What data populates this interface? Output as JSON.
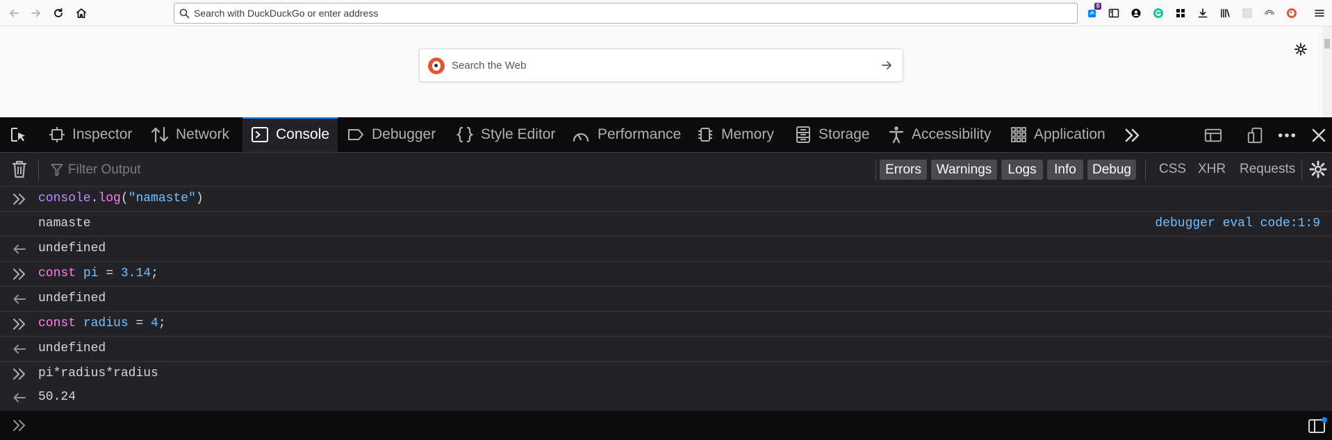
{
  "browser": {
    "urlbar_placeholder": "Search with DuckDuckGo or enter address",
    "extension_badge": "0",
    "icons": [
      "back-arrow-icon",
      "forward-arrow-icon",
      "reload-icon",
      "home-icon",
      "extension-icon",
      "sidebar-icon",
      "account-icon",
      "grammarly-icon",
      "extensions-grid-icon",
      "download-icon",
      "library-icon",
      "container-icon",
      "sync-icon",
      "duckduckgo-icon",
      "hamburger-menu-icon"
    ]
  },
  "page": {
    "ddg_placeholder": "Search the Web"
  },
  "devtools": {
    "tabs": [
      {
        "label": "Inspector",
        "icon": "inspector-icon"
      },
      {
        "label": "Network",
        "icon": "network-icon"
      },
      {
        "label": "Console",
        "icon": "console-icon",
        "selected": true
      },
      {
        "label": "Debugger",
        "icon": "debugger-icon"
      },
      {
        "label": "Style Editor",
        "icon": "style-editor-icon"
      },
      {
        "label": "Performance",
        "icon": "performance-icon"
      },
      {
        "label": "Memory",
        "icon": "memory-icon"
      },
      {
        "label": "Storage",
        "icon": "storage-icon"
      },
      {
        "label": "Accessibility",
        "icon": "accessibility-icon"
      },
      {
        "label": "Application",
        "icon": "application-icon"
      }
    ],
    "accent_color": "#0a84ff",
    "filter_placeholder": "Filter Output",
    "log_filters": [
      "Errors",
      "Warnings",
      "Logs",
      "Info",
      "Debug"
    ],
    "net_filters": [
      "CSS",
      "XHR",
      "Requests"
    ]
  },
  "console": {
    "rows": [
      {
        "type": "input",
        "code": "console.log(\"namaste\")"
      },
      {
        "type": "log",
        "text": "namaste",
        "location": "debugger eval code:1:9"
      },
      {
        "type": "result",
        "text": "undefined"
      },
      {
        "type": "input",
        "code": "const pi = 3.14;"
      },
      {
        "type": "result",
        "text": "undefined"
      },
      {
        "type": "input",
        "code": "const radius = 4;"
      },
      {
        "type": "result",
        "text": "undefined"
      },
      {
        "type": "input",
        "code": "pi*radius*radius"
      },
      {
        "type": "result",
        "text": "50.24"
      }
    ],
    "tokens": {
      "r0": {
        "a": "console",
        "b": ".",
        "c": "log",
        "d": "(",
        "e": "\"namaste\"",
        "f": ")"
      },
      "r3": {
        "a": "const",
        "b": " ",
        "c": "pi",
        "d": " = ",
        "e": "3.14",
        "f": ";"
      },
      "r5": {
        "a": "const",
        "b": " ",
        "c": "radius",
        "d": " = ",
        "e": "4",
        "f": ";"
      },
      "r7": {
        "a": "pi*radius*radius"
      }
    }
  }
}
